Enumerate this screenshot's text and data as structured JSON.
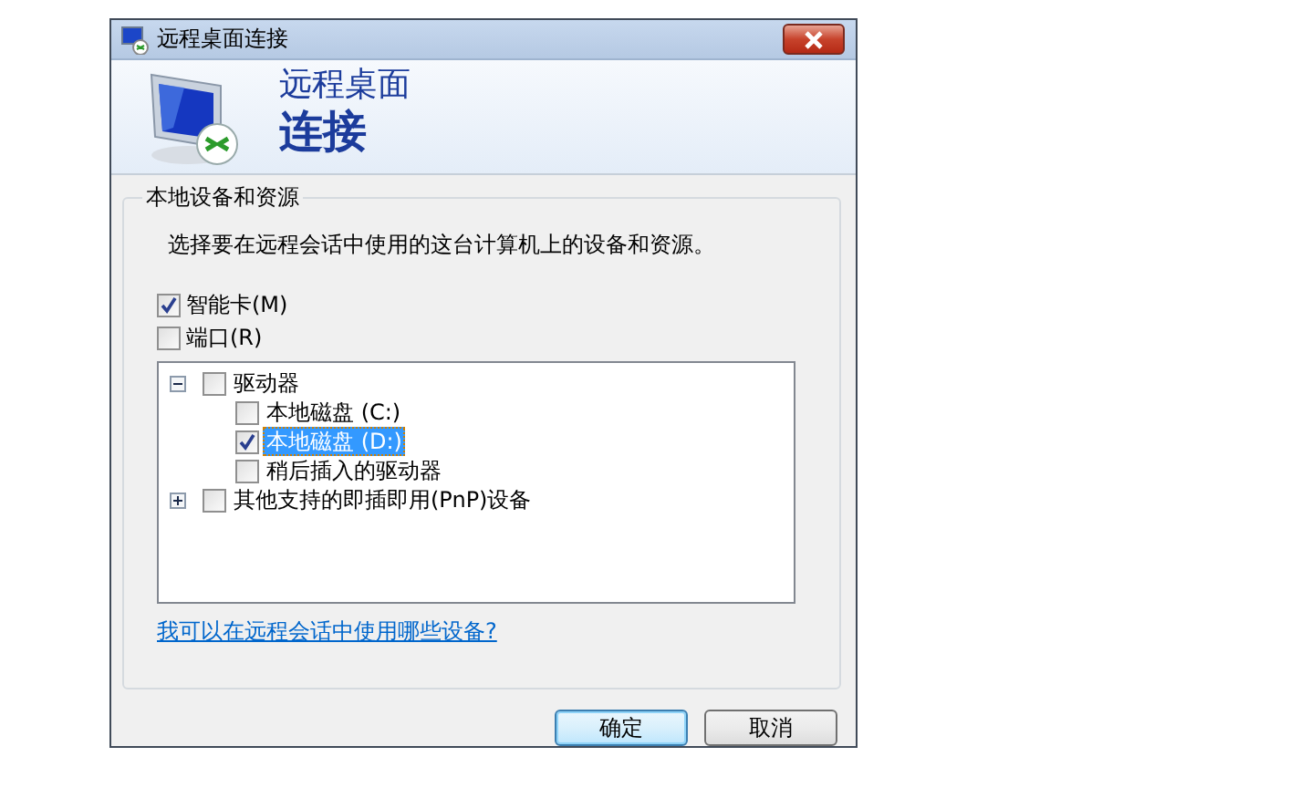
{
  "window": {
    "title": "远程桌面连接"
  },
  "header": {
    "line_1": "远程桌面",
    "line_2": "连接"
  },
  "group": {
    "legend": "本地设备和资源",
    "description": "选择要在远程会话中使用的这台计算机上的设备和资源。",
    "options": [
      {
        "label": "智能卡(M)",
        "checked": true
      },
      {
        "label": "端口(R)",
        "checked": false
      }
    ],
    "tree": [
      {
        "label": "驱动器",
        "checked": false,
        "selected": false,
        "expanded": true,
        "children": [
          {
            "label": "本地磁盘 (C:)",
            "checked": false,
            "selected": false
          },
          {
            "label": "本地磁盘 (D:)",
            "checked": true,
            "selected": true
          },
          {
            "label": "稍后插入的驱动器",
            "checked": false,
            "selected": false
          }
        ]
      },
      {
        "label": "其他支持的即插即用(PnP)设备",
        "checked": false,
        "selected": false,
        "expanded": false
      }
    ],
    "link": "我可以在远程会话中使用哪些设备?"
  },
  "buttons": [
    {
      "label": "确定",
      "default": true
    },
    {
      "label": "取消",
      "default": false
    }
  ]
}
